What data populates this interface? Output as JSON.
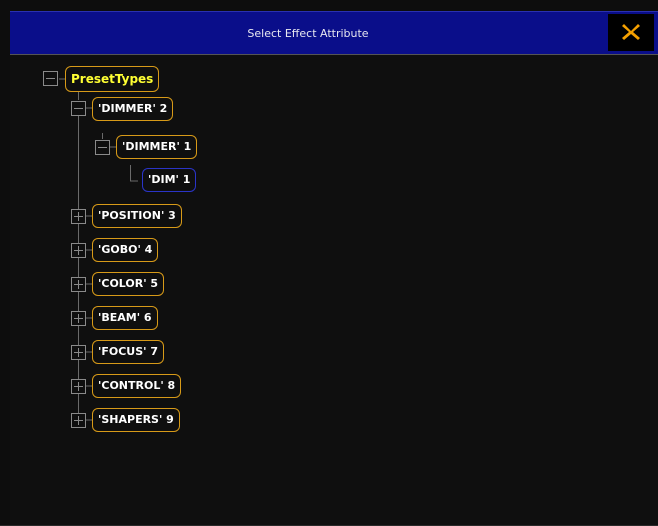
{
  "window": {
    "title": "Select Effect Attribute",
    "close_label": "close"
  },
  "tree": {
    "root": "PresetTypes",
    "nodes": [
      {
        "label": "'DIMMER' 2",
        "state": "expanded"
      },
      {
        "label": "'DIMMER' 1",
        "state": "expanded"
      },
      {
        "label": "'DIM' 1",
        "state": "leaf",
        "selected": true
      },
      {
        "label": "'POSITION' 3",
        "state": "collapsed"
      },
      {
        "label": "'GOBO' 4",
        "state": "collapsed"
      },
      {
        "label": "'COLOR' 5",
        "state": "collapsed"
      },
      {
        "label": "'BEAM' 6",
        "state": "collapsed"
      },
      {
        "label": "'FOCUS' 7",
        "state": "collapsed"
      },
      {
        "label": "'CONTROL' 8",
        "state": "collapsed"
      },
      {
        "label": "'SHAPERS' 9",
        "state": "collapsed"
      }
    ]
  },
  "colors": {
    "title_bar": "#0a0e8a",
    "node_border": "#d79a18",
    "root_text": "#ffff33",
    "selected_border": "#2a34c8",
    "close_icon": "#f5a000"
  },
  "icons": {
    "close": "close-x-icon",
    "expanded": "minus-box-icon",
    "collapsed": "plus-box-icon"
  }
}
